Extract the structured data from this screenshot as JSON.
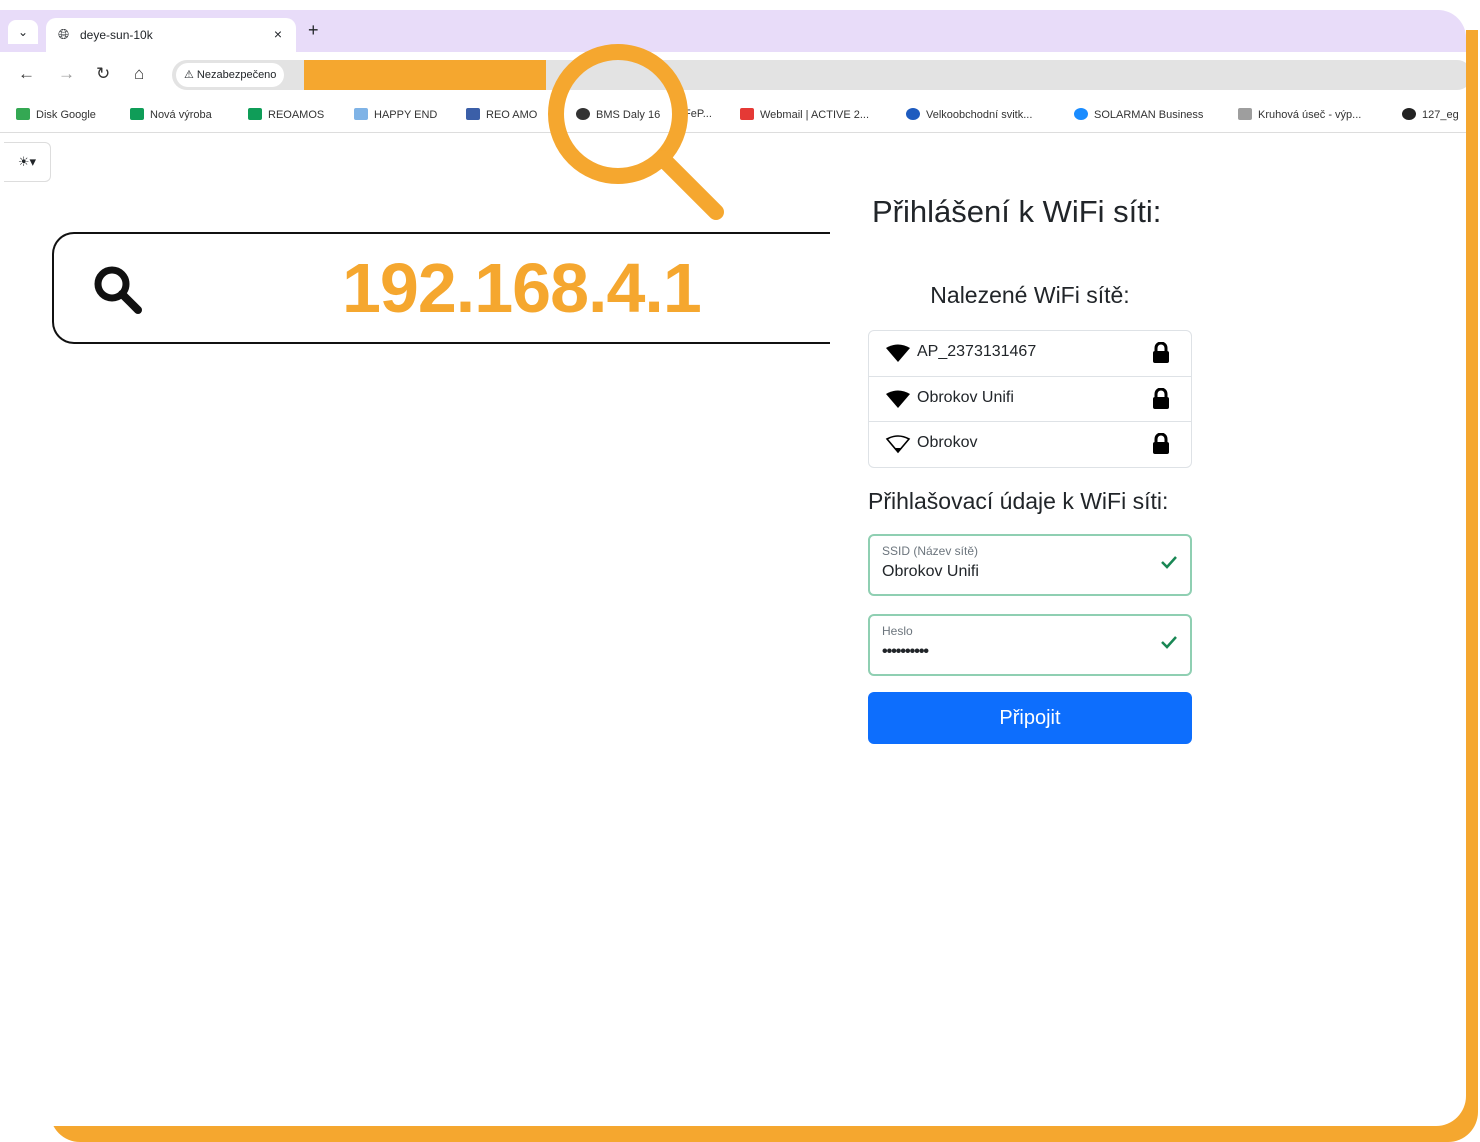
{
  "browser": {
    "tab_title": "deye-sun-10k",
    "tab_close": "×",
    "new_tab": "+",
    "security_label": "⚠ Nezabezpečeno"
  },
  "bookmarks": [
    {
      "label": "Disk Google",
      "color": "#34a853"
    },
    {
      "label": "Nová výroba",
      "color": "#0f9d58"
    },
    {
      "label": "REOAMOS",
      "color": "#0f9d58"
    },
    {
      "label": "HAPPY END",
      "color": "#7fb3e6"
    },
    {
      "label": "REO AMO",
      "color": "#3b5fa8"
    },
    {
      "label": "BMS Daly 16",
      "color": "#333333"
    },
    {
      "label": "FeP...",
      "color": "#ffffff"
    },
    {
      "label": "Webmail | ACTIVE 2...",
      "color": "#e53935"
    },
    {
      "label": "Velkoobchodní svitk...",
      "color": "#1e5bbf"
    },
    {
      "label": "SOLARMAN Business",
      "color": "#1a8cff"
    },
    {
      "label": "Kruhová úseč - výp...",
      "color": "#9e9e9e"
    },
    {
      "label": "127_eg",
      "color": "#222222"
    }
  ],
  "search": {
    "value": "192.168.4.1"
  },
  "login": {
    "title": "Přihlášení k WiFi síti:",
    "networks_heading": "Nalezené WiFi sítě:",
    "networks": [
      {
        "name": "AP_2373131467",
        "signal": "full"
      },
      {
        "name": "Obrokov Unifi",
        "signal": "full"
      },
      {
        "name": "Obrokov",
        "signal": "weak"
      }
    ],
    "credentials_heading": "Přihlašovací údaje k WiFi síti:",
    "ssid_label": "SSID (Název sítě)",
    "ssid_value": "Obrokov Unifi",
    "password_label": "Heslo",
    "password_value": "••••••••••",
    "connect_label": "Připojit"
  },
  "colors": {
    "accent": "#f5a72f",
    "primary_button": "#0d6efd",
    "valid": "#198754"
  }
}
